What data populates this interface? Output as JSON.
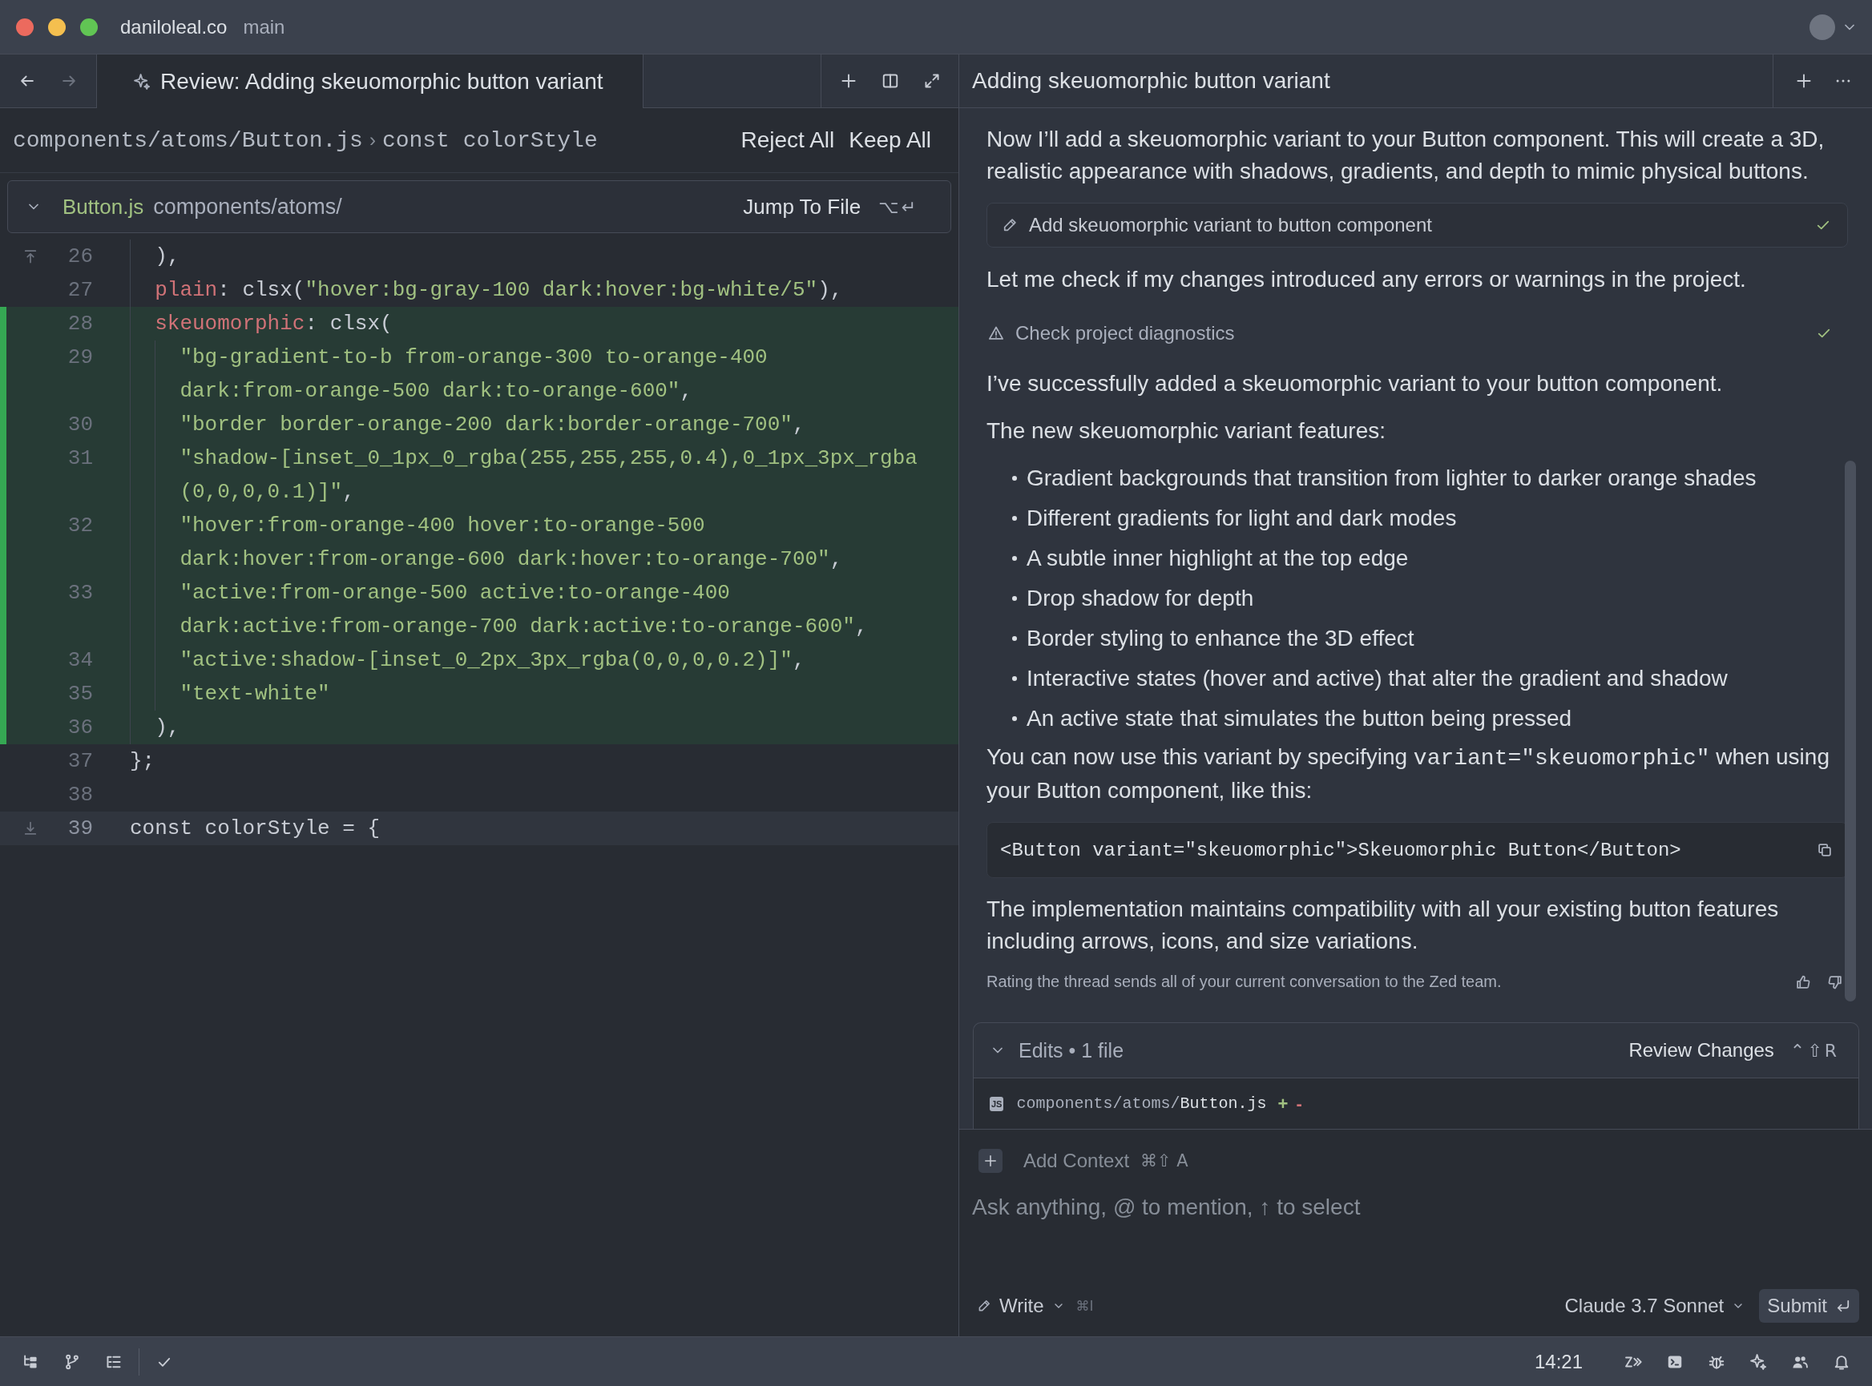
{
  "window": {
    "host": "daniloleal.co",
    "branch": "main"
  },
  "editor_pane": {
    "nav": {
      "back_disabled": false,
      "forward_disabled": true
    },
    "tabs": [
      {
        "title": "Review: Adding skeuomorphic button variant",
        "selected": true
      }
    ],
    "breadcrumb": {
      "path": "components/atoms/Button.js",
      "separator": "›",
      "symbol": "const colorStyle"
    },
    "actions": [
      "Reject All",
      "Keep All"
    ],
    "file_header": {
      "expanded": true,
      "file_name": "Button.js",
      "directory": "components/atoms/",
      "jump_label": "Jump To File",
      "shortcut": "⌥↵"
    },
    "lines": [
      {
        "kind": "group",
        "children": [
          {
            "kind": "expand_up",
            "number": "26",
            "added": false,
            "highlighted": false,
            "rows": [
              [
                {
                  "kind": "default",
                  "text": "),"
                }
              ]
            ]
          },
          {
            "kind": "line",
            "number": "27",
            "added": false,
            "highlighted": false,
            "rows": [
              [
                {
                  "kind": "property",
                  "text": "plain"
                },
                {
                  "kind": "default",
                  "text": ": clsx("
                },
                {
                  "kind": "string",
                  "text": "\"hover:bg-gray-100 dark:hover:bg-white/5\""
                },
                {
                  "kind": "default",
                  "text": "),"
                }
              ]
            ]
          },
          {
            "kind": "line",
            "number": "28",
            "added": true,
            "highlighted": false,
            "rows": [
              [
                {
                  "kind": "property",
                  "text": "skeuomorphic"
                },
                {
                  "kind": "default",
                  "text": ": clsx("
                }
              ]
            ],
            "children": [
              {
                "kind": "line",
                "number": "29",
                "added": true,
                "highlighted": false,
                "rows": [
                  [
                    {
                      "kind": "string",
                      "text": "\"bg-gradient-to-b from-orange-300 to-orange-400"
                    }
                  ],
                  [
                    {
                      "kind": "string",
                      "text": "dark:from-orange-500 dark:to-orange-600\""
                    },
                    {
                      "kind": "default",
                      "text": ","
                    }
                  ]
                ]
              },
              {
                "kind": "line",
                "number": "30",
                "added": true,
                "highlighted": false,
                "rows": [
                  [
                    {
                      "kind": "string",
                      "text": "\"border border-orange-200 dark:border-orange-700\""
                    },
                    {
                      "kind": "default",
                      "text": ","
                    }
                  ]
                ]
              },
              {
                "kind": "line",
                "number": "31",
                "added": true,
                "highlighted": false,
                "rows": [
                  [
                    {
                      "kind": "string",
                      "text": "\"shadow-[inset_0_1px_0_rgba(255,255,255,0.4),0_1px_3px_rgba"
                    }
                  ],
                  [
                    {
                      "kind": "string",
                      "text": "(0,0,0,0.1)]\""
                    },
                    {
                      "kind": "default",
                      "text": ","
                    }
                  ]
                ]
              },
              {
                "kind": "line",
                "number": "32",
                "added": true,
                "highlighted": false,
                "rows": [
                  [
                    {
                      "kind": "string",
                      "text": "\"hover:from-orange-400 hover:to-orange-500"
                    }
                  ],
                  [
                    {
                      "kind": "string",
                      "text": "dark:hover:from-orange-600 dark:hover:to-orange-700\""
                    },
                    {
                      "kind": "default",
                      "text": ","
                    }
                  ]
                ]
              },
              {
                "kind": "line",
                "number": "33",
                "added": true,
                "highlighted": false,
                "rows": [
                  [
                    {
                      "kind": "string",
                      "text": "\"active:from-orange-500 active:to-orange-400"
                    }
                  ],
                  [
                    {
                      "kind": "string",
                      "text": "dark:active:from-orange-700 dark:active:to-orange-600\""
                    },
                    {
                      "kind": "default",
                      "text": ","
                    }
                  ]
                ]
              },
              {
                "kind": "line",
                "number": "34",
                "added": true,
                "highlighted": false,
                "rows": [
                  [
                    {
                      "kind": "string",
                      "text": "\"active:shadow-[inset_0_2px_3px_rgba(0,0,0,0.2)]\""
                    },
                    {
                      "kind": "default",
                      "text": ","
                    }
                  ]
                ]
              },
              {
                "kind": "line",
                "number": "35",
                "added": true,
                "highlighted": false,
                "rows": [
                  [
                    {
                      "kind": "string",
                      "text": "\"text-white\""
                    }
                  ]
                ]
              }
            ]
          },
          {
            "kind": "line",
            "number": "36",
            "added": true,
            "highlighted": false,
            "rows": [
              [
                {
                  "kind": "default",
                  "text": "),"
                }
              ]
            ]
          }
        ]
      },
      {
        "kind": "line",
        "number": "37",
        "added": false,
        "highlighted": false,
        "rows": [
          [
            {
              "kind": "default",
              "text": "};"
            }
          ]
        ]
      },
      {
        "kind": "line",
        "number": "38",
        "added": false,
        "highlighted": false
      },
      {
        "kind": "expand_down",
        "number": "39",
        "added": false,
        "highlighted": true,
        "rows": [
          [
            {
              "kind": "default",
              "text": "const colorStyle = {"
            }
          ]
        ]
      }
    ]
  },
  "thread_pane": {
    "title": "Adding skeuomorphic button variant",
    "content": [
      {
        "kind": "paragraph",
        "text": "Now I’ll add a skeuomorphic variant to your Button component. This will create a 3D, realistic appearance with shadows, gradients, and depth to mimic physical buttons."
      },
      {
        "kind": "edit_tool",
        "label": "Add skeuomorphic variant to button component",
        "done": true
      },
      {
        "kind": "paragraph",
        "text": "Let me check if my changes introduced any errors or warnings in the project."
      },
      {
        "kind": "diagnostics_tool",
        "label": "Check project diagnostics",
        "done": true
      },
      {
        "kind": "paragraph",
        "text": "I’ve successfully added a skeuomorphic variant to your button component."
      },
      {
        "kind": "paragraph",
        "text": "The new skeuomorphic variant features:"
      },
      {
        "kind": "bullets",
        "items": [
          "Gradient backgrounds that transition from lighter to darker orange shades",
          "Different gradients for light and dark modes",
          "A subtle inner highlight at the top edge",
          "Drop shadow for depth",
          "Border styling to enhance the 3D effect",
          "Interactive states (hover and active) that alter the gradient and shadow",
          "An active state that simulates the button being pressed"
        ]
      },
      {
        "kind": "paragraph",
        "parts": [
          {
            "text": "You can now use this variant by specifying ",
            "code": false
          },
          {
            "text": "variant=\"skeuomorphic\"",
            "code": true
          },
          {
            "text": " when using your Button component, like this:",
            "code": false
          }
        ]
      },
      {
        "kind": "code_block",
        "code": "<Button variant=\"skeuomorphic\">Skeuomorphic Button</Button>"
      },
      {
        "kind": "paragraph",
        "text": "The implementation maintains compatibility with all your existing button features including arrows, icons, and size variations."
      }
    ],
    "rating_notice": "Rating the thread sends all of your current conversation to the Zed team.",
    "edits": {
      "expanded": true,
      "summary": "Edits • 1 file",
      "review_label": "Review Changes",
      "shortcut": "⌃⇧R",
      "files": [
        {
          "badge": "JS",
          "directory": "components/atoms/",
          "name": "Button.js",
          "added": "+",
          "removed": "-"
        }
      ]
    },
    "composer": {
      "add_context": "Add Context",
      "add_context_shortcut": "⌘⇧ A",
      "placeholder": "Ask anything, @ to mention, ↑ to select",
      "mode": "Write",
      "mode_shortcut": "⌘I",
      "model": "Claude 3.7 Sonnet",
      "submit": "Submit"
    }
  },
  "status_bar": {
    "time": "14:21"
  }
}
